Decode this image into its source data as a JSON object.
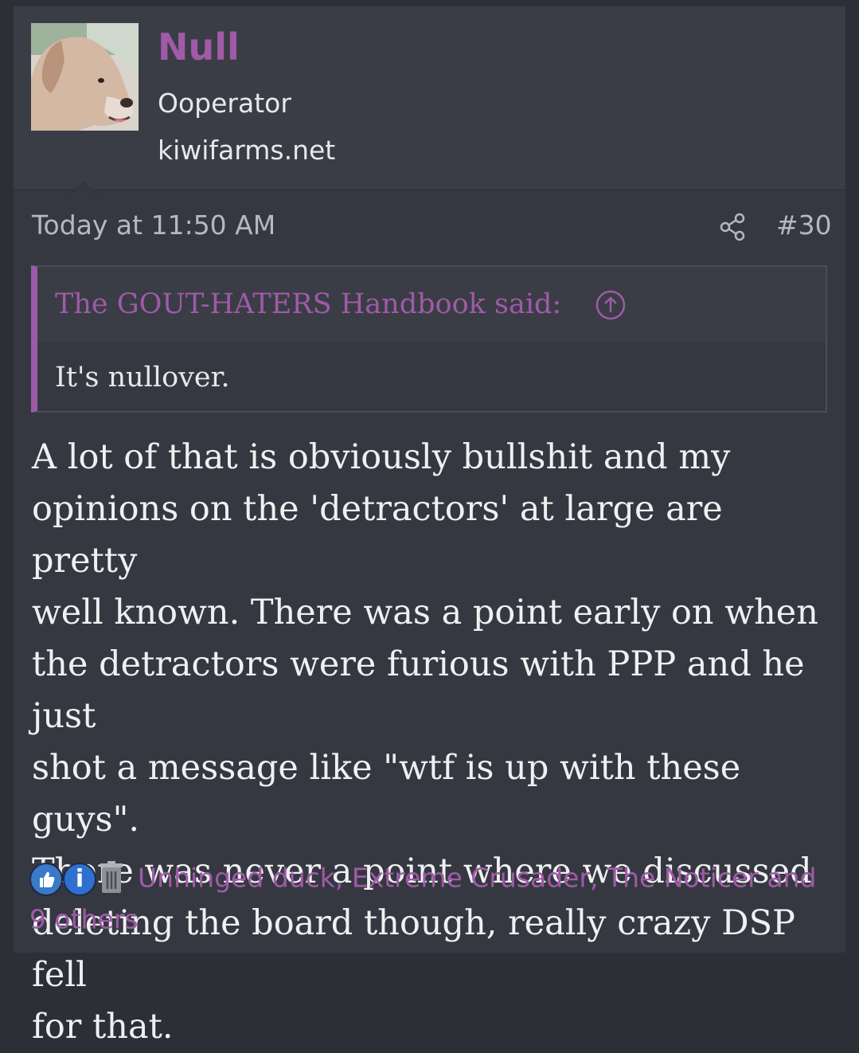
{
  "user": {
    "name": "Null",
    "title": "Ooperator",
    "banner": "kiwifarms.net"
  },
  "post": {
    "time": "Today at 11:50 AM",
    "number": "#30"
  },
  "quote": {
    "attribution": "The GOUT-HATERS Handbook said:",
    "text": "It's nullover."
  },
  "message": {
    "lines": [
      "A lot of that is obviously bullshit and my",
      "opinions on the 'detractors' at large are pretty",
      "well known. There was a point early on when",
      "the detractors were furious with PPP and he just",
      "shot a message like \"wtf is up with these guys\".",
      "There was never a point where we discussed",
      "deleting the board though, really crazy DSP fell",
      "for that."
    ]
  },
  "reactions": {
    "icons": [
      "like-icon",
      "informative-icon",
      "trash-icon"
    ],
    "text": "Unhinged duck, Extreme Crusader, The Noticer and 9 others"
  },
  "colors": {
    "accent": "#a05aa8",
    "background": "#353840",
    "text": "#f0f0f2"
  }
}
